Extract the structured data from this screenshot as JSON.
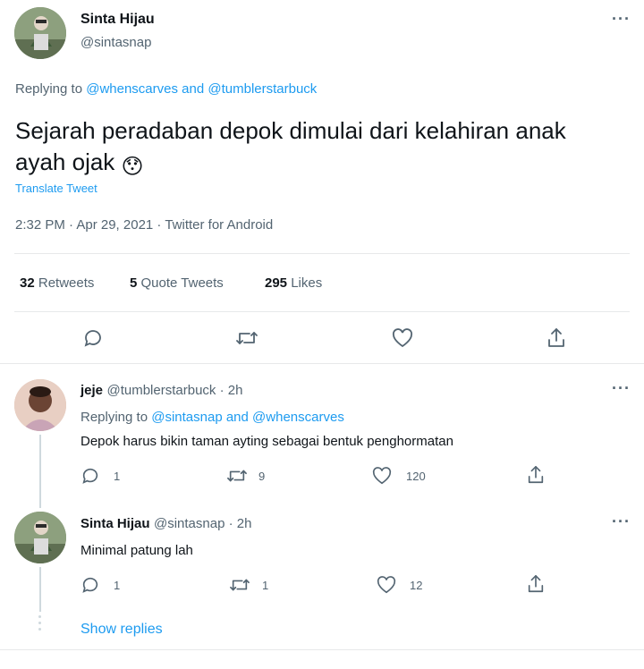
{
  "main_tweet": {
    "author_name": "Sinta Hijau",
    "author_handle": "@sintasnap",
    "replying_prefix": "Replying to",
    "replying_user_1": "@whenscarves",
    "replying_and": "and",
    "replying_user_2": "@tumblerstarbuck",
    "text_line_1": "Sejarah peradaban depok dimulai dari kelahiran anak",
    "text_line_2": "ayah ojak",
    "emoji": "😯",
    "translate_label": "Translate Tweet",
    "timestamp": "2:32 PM · Apr 29, 2021 · Twitter for Android",
    "stats": {
      "retweets_count": "32",
      "retweets_label": "Retweets",
      "quotes_count": "5",
      "quotes_label": "Quote Tweets",
      "likes_count": "295",
      "likes_label": "Likes"
    }
  },
  "replies": [
    {
      "author_name": "jeje",
      "author_handle_time": "@tumblerstarbuck · 2h",
      "replying_prefix": "Replying to",
      "replying_user_1": "@sintasnap",
      "replying_and": "and",
      "replying_user_2": "@whenscarves",
      "text": "Depok harus bikin taman ayting sebagai bentuk penghormatan",
      "reply_count": "1",
      "retweet_count": "9",
      "like_count": "120"
    },
    {
      "author_name": "Sinta Hijau",
      "author_handle_time": "@sintasnap · 2h",
      "text": "Minimal patung lah",
      "reply_count": "1",
      "retweet_count": "1",
      "like_count": "12"
    }
  ],
  "show_replies_label": "Show replies",
  "more_label": "···",
  "icons": {
    "reply": "reply-icon",
    "retweet": "retweet-icon",
    "like": "heart-icon",
    "share": "share-icon",
    "more": "more-icon"
  },
  "colors": {
    "link": "#1d9bf0",
    "secondary_text": "#536471",
    "divider": "#e7e9ea"
  }
}
